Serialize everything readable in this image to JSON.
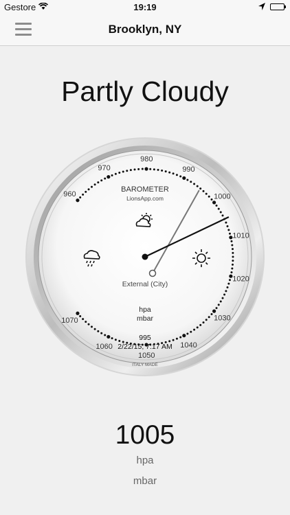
{
  "status_bar": {
    "carrier": "Gestore",
    "time": "19:19"
  },
  "nav": {
    "title": "Brooklyn, NY"
  },
  "condition": "Partly Cloudy",
  "gauge": {
    "brand": "BAROMETER",
    "site": "LionsApp.com",
    "source": "External (City)",
    "unit_hpa": "hpa",
    "unit_mbar": "mbar",
    "reference_value": "995",
    "reference_time": "2/22/15, 7:17 AM",
    "made": "ITALY MADE",
    "scale_labels": [
      "960",
      "970",
      "980",
      "990",
      "1000",
      "1010",
      "1020",
      "1030",
      "1040",
      "1050",
      "1060",
      "1070"
    ],
    "scale_min": 960,
    "scale_max": 1070,
    "current_needle": 1005,
    "reference_needle": 995,
    "icons": [
      "rain-cloud-icon",
      "partly-cloudy-icon",
      "sun-icon"
    ]
  },
  "reading": {
    "value": "1005",
    "unit1": "hpa",
    "unit2": "mbar"
  }
}
